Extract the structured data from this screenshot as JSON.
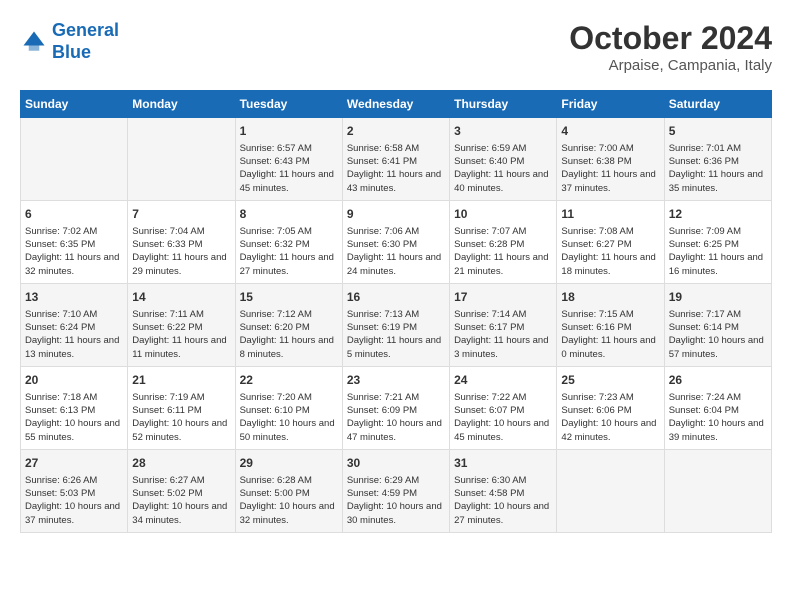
{
  "logo": {
    "text_general": "General",
    "text_blue": "Blue"
  },
  "header": {
    "month": "October 2024",
    "location": "Arpaise, Campania, Italy"
  },
  "days_of_week": [
    "Sunday",
    "Monday",
    "Tuesday",
    "Wednesday",
    "Thursday",
    "Friday",
    "Saturday"
  ],
  "weeks": [
    [
      {
        "day": "",
        "content": ""
      },
      {
        "day": "",
        "content": ""
      },
      {
        "day": "1",
        "content": "Sunrise: 6:57 AM\nSunset: 6:43 PM\nDaylight: 11 hours and 45 minutes."
      },
      {
        "day": "2",
        "content": "Sunrise: 6:58 AM\nSunset: 6:41 PM\nDaylight: 11 hours and 43 minutes."
      },
      {
        "day": "3",
        "content": "Sunrise: 6:59 AM\nSunset: 6:40 PM\nDaylight: 11 hours and 40 minutes."
      },
      {
        "day": "4",
        "content": "Sunrise: 7:00 AM\nSunset: 6:38 PM\nDaylight: 11 hours and 37 minutes."
      },
      {
        "day": "5",
        "content": "Sunrise: 7:01 AM\nSunset: 6:36 PM\nDaylight: 11 hours and 35 minutes."
      }
    ],
    [
      {
        "day": "6",
        "content": "Sunrise: 7:02 AM\nSunset: 6:35 PM\nDaylight: 11 hours and 32 minutes."
      },
      {
        "day": "7",
        "content": "Sunrise: 7:04 AM\nSunset: 6:33 PM\nDaylight: 11 hours and 29 minutes."
      },
      {
        "day": "8",
        "content": "Sunrise: 7:05 AM\nSunset: 6:32 PM\nDaylight: 11 hours and 27 minutes."
      },
      {
        "day": "9",
        "content": "Sunrise: 7:06 AM\nSunset: 6:30 PM\nDaylight: 11 hours and 24 minutes."
      },
      {
        "day": "10",
        "content": "Sunrise: 7:07 AM\nSunset: 6:28 PM\nDaylight: 11 hours and 21 minutes."
      },
      {
        "day": "11",
        "content": "Sunrise: 7:08 AM\nSunset: 6:27 PM\nDaylight: 11 hours and 18 minutes."
      },
      {
        "day": "12",
        "content": "Sunrise: 7:09 AM\nSunset: 6:25 PM\nDaylight: 11 hours and 16 minutes."
      }
    ],
    [
      {
        "day": "13",
        "content": "Sunrise: 7:10 AM\nSunset: 6:24 PM\nDaylight: 11 hours and 13 minutes."
      },
      {
        "day": "14",
        "content": "Sunrise: 7:11 AM\nSunset: 6:22 PM\nDaylight: 11 hours and 11 minutes."
      },
      {
        "day": "15",
        "content": "Sunrise: 7:12 AM\nSunset: 6:20 PM\nDaylight: 11 hours and 8 minutes."
      },
      {
        "day": "16",
        "content": "Sunrise: 7:13 AM\nSunset: 6:19 PM\nDaylight: 11 hours and 5 minutes."
      },
      {
        "day": "17",
        "content": "Sunrise: 7:14 AM\nSunset: 6:17 PM\nDaylight: 11 hours and 3 minutes."
      },
      {
        "day": "18",
        "content": "Sunrise: 7:15 AM\nSunset: 6:16 PM\nDaylight: 11 hours and 0 minutes."
      },
      {
        "day": "19",
        "content": "Sunrise: 7:17 AM\nSunset: 6:14 PM\nDaylight: 10 hours and 57 minutes."
      }
    ],
    [
      {
        "day": "20",
        "content": "Sunrise: 7:18 AM\nSunset: 6:13 PM\nDaylight: 10 hours and 55 minutes."
      },
      {
        "day": "21",
        "content": "Sunrise: 7:19 AM\nSunset: 6:11 PM\nDaylight: 10 hours and 52 minutes."
      },
      {
        "day": "22",
        "content": "Sunrise: 7:20 AM\nSunset: 6:10 PM\nDaylight: 10 hours and 50 minutes."
      },
      {
        "day": "23",
        "content": "Sunrise: 7:21 AM\nSunset: 6:09 PM\nDaylight: 10 hours and 47 minutes."
      },
      {
        "day": "24",
        "content": "Sunrise: 7:22 AM\nSunset: 6:07 PM\nDaylight: 10 hours and 45 minutes."
      },
      {
        "day": "25",
        "content": "Sunrise: 7:23 AM\nSunset: 6:06 PM\nDaylight: 10 hours and 42 minutes."
      },
      {
        "day": "26",
        "content": "Sunrise: 7:24 AM\nSunset: 6:04 PM\nDaylight: 10 hours and 39 minutes."
      }
    ],
    [
      {
        "day": "27",
        "content": "Sunrise: 6:26 AM\nSunset: 5:03 PM\nDaylight: 10 hours and 37 minutes."
      },
      {
        "day": "28",
        "content": "Sunrise: 6:27 AM\nSunset: 5:02 PM\nDaylight: 10 hours and 34 minutes."
      },
      {
        "day": "29",
        "content": "Sunrise: 6:28 AM\nSunset: 5:00 PM\nDaylight: 10 hours and 32 minutes."
      },
      {
        "day": "30",
        "content": "Sunrise: 6:29 AM\nSunset: 4:59 PM\nDaylight: 10 hours and 30 minutes."
      },
      {
        "day": "31",
        "content": "Sunrise: 6:30 AM\nSunset: 4:58 PM\nDaylight: 10 hours and 27 minutes."
      },
      {
        "day": "",
        "content": ""
      },
      {
        "day": "",
        "content": ""
      }
    ]
  ]
}
